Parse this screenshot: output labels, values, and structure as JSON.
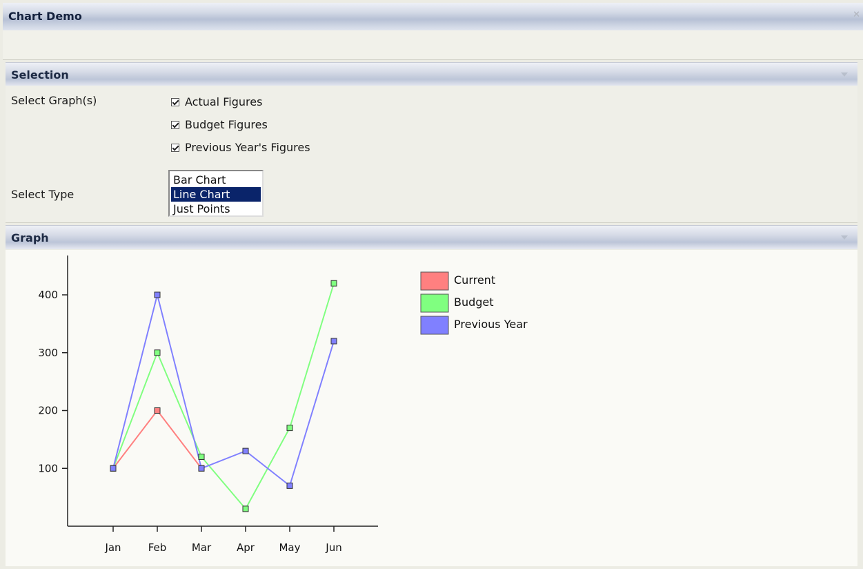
{
  "window": {
    "title": "Chart Demo",
    "close_icon": "close-icon"
  },
  "selection": {
    "header": "Selection",
    "select_graphs_label": "Select Graph(s)",
    "checkboxes": [
      {
        "label": "Actual Figures",
        "checked": true
      },
      {
        "label": "Budget Figures",
        "checked": true
      },
      {
        "label": "Previous Year's Figures",
        "checked": true
      }
    ],
    "select_type_label": "Select Type",
    "type_options": [
      "Bar Chart",
      "Line Chart",
      "Just Points"
    ],
    "type_selected": "Line Chart"
  },
  "graph": {
    "header": "Graph"
  },
  "chart_data": {
    "type": "line",
    "categories": [
      "Jan",
      "Feb",
      "Mar",
      "Apr",
      "May",
      "Jun"
    ],
    "y_ticks": [
      "100",
      "200",
      "300",
      "400"
    ],
    "ylim": [
      0,
      460
    ],
    "series": [
      {
        "name": "Current",
        "color": "#ff8080",
        "values": [
          100,
          200,
          100,
          null,
          null,
          null
        ]
      },
      {
        "name": "Budget",
        "color": "#80ff80",
        "values": [
          100,
          300,
          120,
          30,
          170,
          420
        ]
      },
      {
        "name": "Previous Year",
        "color": "#8080ff",
        "values": [
          100,
          400,
          100,
          130,
          70,
          320
        ]
      }
    ],
    "legend_position": "top-right",
    "grid": false
  }
}
